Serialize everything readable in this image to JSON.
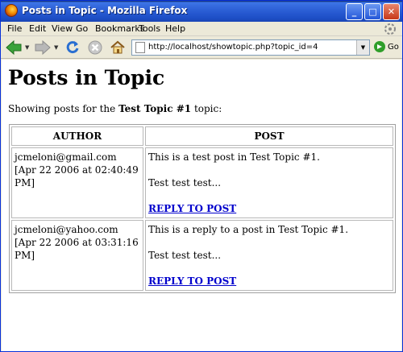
{
  "window": {
    "title": "Posts in Topic - Mozilla Firefox",
    "minimize_label": "_",
    "maximize_label": "□",
    "close_label": "✕"
  },
  "menubar": {
    "items": [
      "File",
      "Edit",
      "View",
      "Go",
      "Bookmarks",
      "Tools",
      "Help"
    ]
  },
  "navbar": {
    "url": "http://localhost/showtopic.php?topic_id=4",
    "go_label": "Go"
  },
  "page": {
    "heading": "Posts in Topic",
    "intro_prefix": "Showing posts for the ",
    "topic_name": "Test Topic #1",
    "intro_suffix": " topic:",
    "table": {
      "headers": [
        "AUTHOR",
        "POST"
      ],
      "rows": [
        {
          "author": "jcmeloni@gmail.com",
          "date": "[Apr 22 2006 at 02:40:49 PM]",
          "post_line1": "This is a test post in Test Topic #1.",
          "post_line2": "Test test test...",
          "reply_label": "REPLY TO POST"
        },
        {
          "author": "jcmeloni@yahoo.com",
          "date": "[Apr 22 2006 at 03:31:16 PM]",
          "post_line1": "This is a reply to a post in Test Topic #1.",
          "post_line2": "Test test test...",
          "reply_label": "REPLY TO POST"
        }
      ]
    }
  },
  "colors": {
    "titlebar": "#2c5fd6",
    "link": "#0000cc",
    "chrome": "#ece9d8"
  }
}
